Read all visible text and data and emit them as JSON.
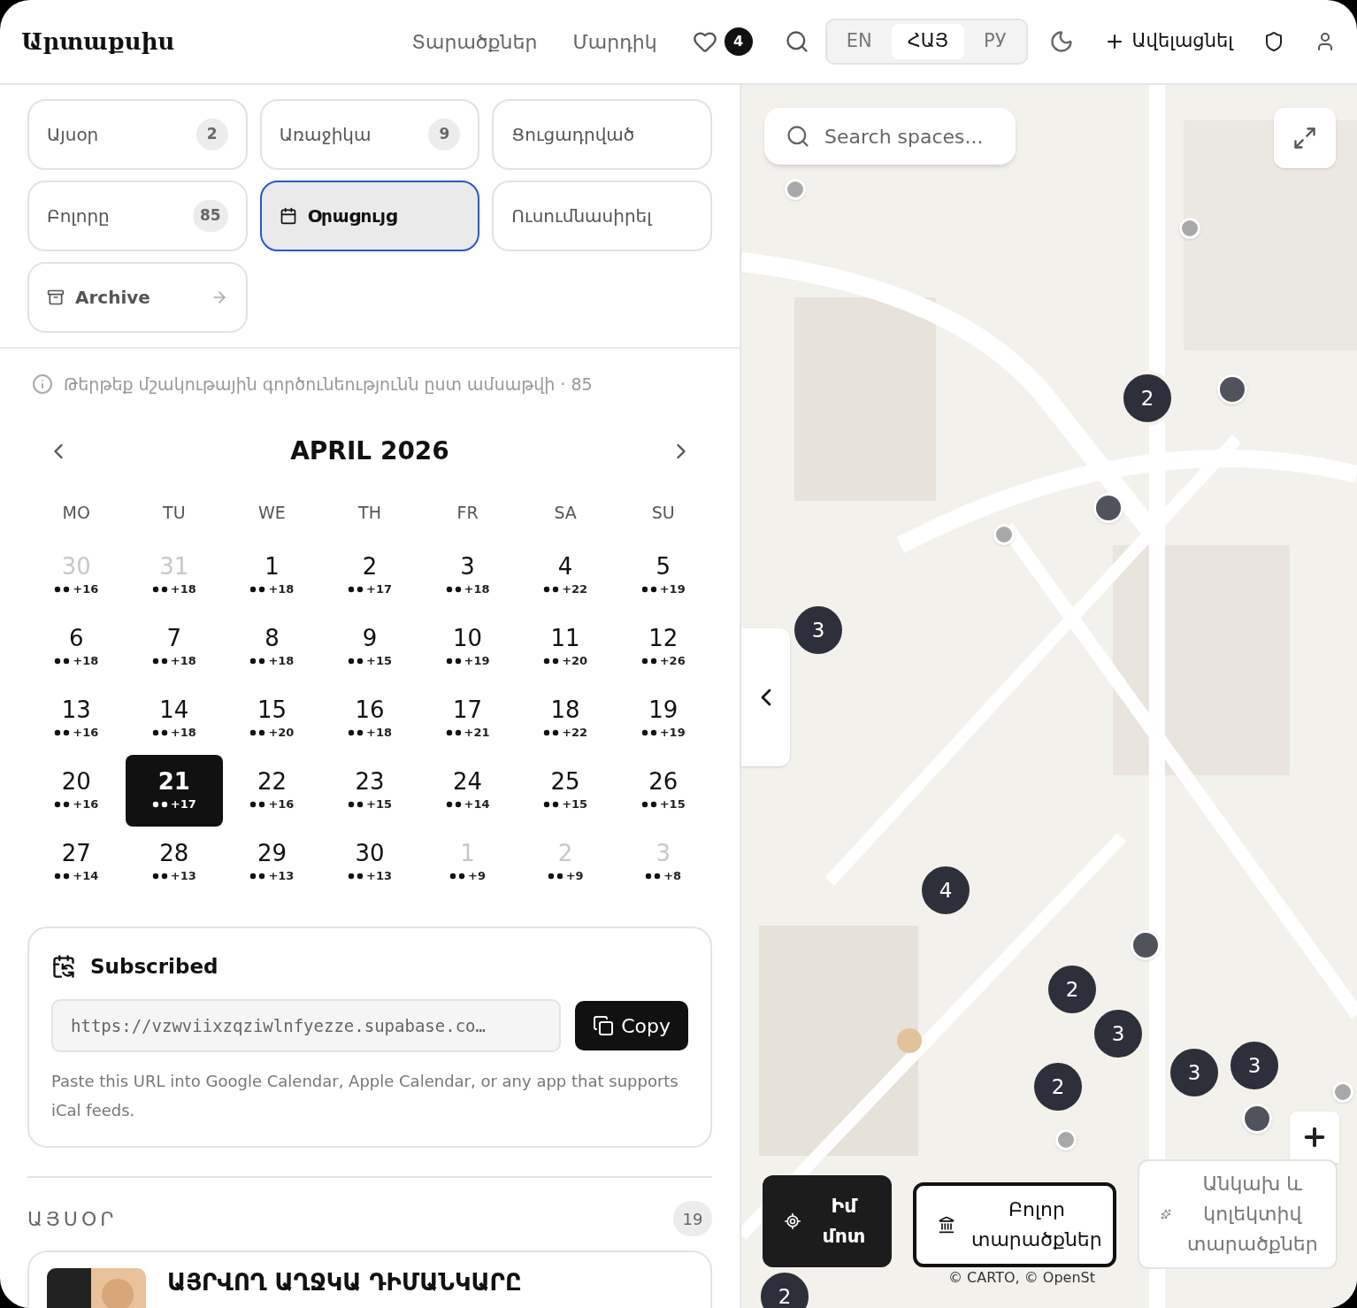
{
  "header": {
    "logo": "Արտաքսիս",
    "nav": [
      {
        "label": "Տարածքներ"
      },
      {
        "label": "Մարդիկ"
      }
    ],
    "favorites_count": "4",
    "languages": [
      {
        "label": "EN",
        "selected": false
      },
      {
        "label": "ՀԱՅ",
        "selected": true
      },
      {
        "label": "РУ",
        "selected": false
      }
    ],
    "add_button": "Ավելացնել"
  },
  "filters": [
    {
      "label": "Այսօր",
      "count": "2",
      "kind": "count",
      "selected": false
    },
    {
      "label": "Առաջիկա",
      "count": "9",
      "kind": "count",
      "selected": false
    },
    {
      "label": "Ցուցադրված",
      "kind": "plain",
      "selected": false
    },
    {
      "label": "Բոլորը",
      "count": "85",
      "kind": "count",
      "selected": false
    },
    {
      "label": "Օրացույց",
      "kind": "calendar",
      "selected": true
    },
    {
      "label": "Ուսումնասիրել",
      "kind": "plain",
      "selected": false
    },
    {
      "label": "Archive",
      "kind": "archive",
      "selected": false
    }
  ],
  "info": "Թերթեք մշակութային գործունեությունն ըստ ամսաթվի · 85",
  "calendar": {
    "title": "APRIL 2026",
    "weekdays": [
      "MO",
      "TU",
      "WE",
      "TH",
      "FR",
      "SA",
      "SU"
    ],
    "days": [
      {
        "day": "30",
        "extra": "+16",
        "in_month": false,
        "selected": false
      },
      {
        "day": "31",
        "extra": "+18",
        "in_month": false,
        "selected": false
      },
      {
        "day": "1",
        "extra": "+18",
        "in_month": true,
        "selected": false
      },
      {
        "day": "2",
        "extra": "+17",
        "in_month": true,
        "selected": false
      },
      {
        "day": "3",
        "extra": "+18",
        "in_month": true,
        "selected": false
      },
      {
        "day": "4",
        "extra": "+22",
        "in_month": true,
        "selected": false
      },
      {
        "day": "5",
        "extra": "+19",
        "in_month": true,
        "selected": false
      },
      {
        "day": "6",
        "extra": "+18",
        "in_month": true,
        "selected": false
      },
      {
        "day": "7",
        "extra": "+18",
        "in_month": true,
        "selected": false
      },
      {
        "day": "8",
        "extra": "+18",
        "in_month": true,
        "selected": false
      },
      {
        "day": "9",
        "extra": "+15",
        "in_month": true,
        "selected": false
      },
      {
        "day": "10",
        "extra": "+19",
        "in_month": true,
        "selected": false
      },
      {
        "day": "11",
        "extra": "+20",
        "in_month": true,
        "selected": false
      },
      {
        "day": "12",
        "extra": "+26",
        "in_month": true,
        "selected": false
      },
      {
        "day": "13",
        "extra": "+16",
        "in_month": true,
        "selected": false
      },
      {
        "day": "14",
        "extra": "+18",
        "in_month": true,
        "selected": false
      },
      {
        "day": "15",
        "extra": "+20",
        "in_month": true,
        "selected": false
      },
      {
        "day": "16",
        "extra": "+18",
        "in_month": true,
        "selected": false
      },
      {
        "day": "17",
        "extra": "+21",
        "in_month": true,
        "selected": false
      },
      {
        "day": "18",
        "extra": "+22",
        "in_month": true,
        "selected": false
      },
      {
        "day": "19",
        "extra": "+19",
        "in_month": true,
        "selected": false
      },
      {
        "day": "20",
        "extra": "+16",
        "in_month": true,
        "selected": false
      },
      {
        "day": "21",
        "extra": "+17",
        "in_month": true,
        "selected": true
      },
      {
        "day": "22",
        "extra": "+16",
        "in_month": true,
        "selected": false
      },
      {
        "day": "23",
        "extra": "+15",
        "in_month": true,
        "selected": false
      },
      {
        "day": "24",
        "extra": "+14",
        "in_month": true,
        "selected": false
      },
      {
        "day": "25",
        "extra": "+15",
        "in_month": true,
        "selected": false
      },
      {
        "day": "26",
        "extra": "+15",
        "in_month": true,
        "selected": false
      },
      {
        "day": "27",
        "extra": "+14",
        "in_month": true,
        "selected": false
      },
      {
        "day": "28",
        "extra": "+13",
        "in_month": true,
        "selected": false
      },
      {
        "day": "29",
        "extra": "+13",
        "in_month": true,
        "selected": false
      },
      {
        "day": "30",
        "extra": "+13",
        "in_month": true,
        "selected": false
      },
      {
        "day": "1",
        "extra": "+9",
        "in_month": false,
        "selected": false
      },
      {
        "day": "2",
        "extra": "+9",
        "in_month": false,
        "selected": false
      },
      {
        "day": "3",
        "extra": "+8",
        "in_month": false,
        "selected": false
      }
    ]
  },
  "subscription": {
    "title": "Subscribed",
    "url": "https://vzwviixzqziwlnfyezze.supabase.co…",
    "button": "Copy",
    "note": "Paste this URL into Google Calendar, Apple Calendar, or any app that supports iCal feeds."
  },
  "today": {
    "heading": "ԱՅՍՕՐ",
    "count": "19",
    "events": [
      {
        "title": "ԱՅՐՎՈՂ ԱՂՋԿԱ ԴԻՄԱՆԿԱՐԸ"
      }
    ]
  },
  "map": {
    "search_placeholder": "Search spaces...",
    "clusters": [
      "2",
      "3",
      "4",
      "2",
      "3",
      "2",
      "3",
      "3",
      "2"
    ],
    "attribution": "© CARTO, © OpenSt",
    "filters": [
      {
        "label": "Իմ մոտ",
        "kind": "near",
        "selected": true,
        "focused": false
      },
      {
        "label": "Բոլոր տարածքներ",
        "kind": "all",
        "selected": false,
        "focused": true
      },
      {
        "label": "Անկախ և կոլեկտիվ տարածքներ",
        "kind": "independent",
        "selected": false,
        "focused": false
      }
    ]
  }
}
